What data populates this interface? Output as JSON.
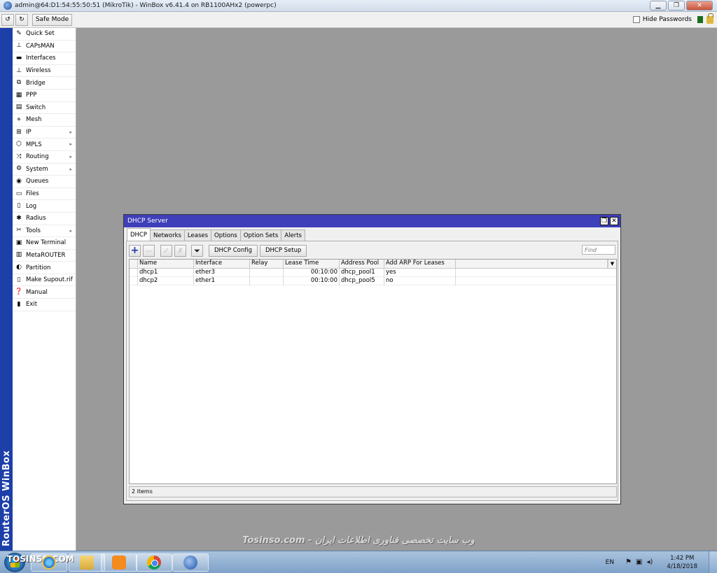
{
  "window": {
    "title": "admin@64:D1:54:55:50:51 (MikroTik) - WinBox v6.41.4 on RB1100AHx2 (powerpc)",
    "minimize": "▁",
    "maximize": "❐",
    "close": "✕"
  },
  "toolbar": {
    "undo_icon": "↺",
    "redo_icon": "↻",
    "safe_mode": "Safe Mode",
    "hide_passwords": "Hide Passwords"
  },
  "brand": "RouterOS WinBox",
  "sidebar": {
    "items": [
      {
        "label": "Quick Set",
        "icon": "✎",
        "has_submenu": false
      },
      {
        "label": "CAPsMAN",
        "icon": "⊥",
        "has_submenu": false
      },
      {
        "label": "Interfaces",
        "icon": "▬",
        "has_submenu": false
      },
      {
        "label": "Wireless",
        "icon": "⊥",
        "has_submenu": false
      },
      {
        "label": "Bridge",
        "icon": "⧉",
        "has_submenu": false
      },
      {
        "label": "PPP",
        "icon": "▦",
        "has_submenu": false
      },
      {
        "label": "Switch",
        "icon": "▤",
        "has_submenu": false
      },
      {
        "label": "Mesh",
        "icon": "⋄",
        "has_submenu": false
      },
      {
        "label": "IP",
        "icon": "⊞",
        "has_submenu": true
      },
      {
        "label": "MPLS",
        "icon": "⬡",
        "has_submenu": true
      },
      {
        "label": "Routing",
        "icon": "⤨",
        "has_submenu": true
      },
      {
        "label": "System",
        "icon": "⚙",
        "has_submenu": true
      },
      {
        "label": "Queues",
        "icon": "◉",
        "has_submenu": false
      },
      {
        "label": "Files",
        "icon": "▭",
        "has_submenu": false
      },
      {
        "label": "Log",
        "icon": "▯",
        "has_submenu": false
      },
      {
        "label": "Radius",
        "icon": "✱",
        "has_submenu": false
      },
      {
        "label": "Tools",
        "icon": "✂",
        "has_submenu": true
      },
      {
        "label": "New Terminal",
        "icon": "▣",
        "has_submenu": false
      },
      {
        "label": "MetaROUTER",
        "icon": "▥",
        "has_submenu": false
      },
      {
        "label": "Partition",
        "icon": "◐",
        "has_submenu": false
      },
      {
        "label": "Make Supout.rif",
        "icon": "▯",
        "has_submenu": false
      },
      {
        "label": "Manual",
        "icon": "❓",
        "has_submenu": false
      },
      {
        "label": "Exit",
        "icon": "▮",
        "has_submenu": false
      }
    ],
    "submenu_arrow": "▸"
  },
  "dhcp_window": {
    "title": "DHCP Server",
    "restore_icon": "❐",
    "close_icon": "✕",
    "tabs": [
      "DHCP",
      "Networks",
      "Leases",
      "Options",
      "Option Sets",
      "Alerts"
    ],
    "active_tab": "DHCP",
    "buttons": {
      "add": "+",
      "remove": "—",
      "enable": "✓",
      "disable": "✗",
      "filter": "⏷",
      "dhcp_config": "DHCP Config",
      "dhcp_setup": "DHCP Setup"
    },
    "find_placeholder": "Find",
    "columns": [
      "Name",
      "Interface",
      "Relay",
      "Lease Time",
      "Address Pool",
      "Add ARP For Leases"
    ],
    "column_dropdown": "▼",
    "rows": [
      {
        "name": "dhcp1",
        "interface": "ether3",
        "relay": "",
        "lease_time": "00:10:00",
        "address_pool": "dhcp_pool1",
        "add_arp": "yes"
      },
      {
        "name": "dhcp2",
        "interface": "ether1",
        "relay": "",
        "lease_time": "00:10:00",
        "address_pool": "dhcp_pool5",
        "add_arp": "no"
      }
    ],
    "status": "2 items"
  },
  "watermark": "Tosinso.com - وب سایت تخصصی فناوری اطلاعات ایران",
  "taskbar": {
    "logo_text": "TOSINSO.COM",
    "language": "EN",
    "time": "1:42 PM",
    "date": "4/18/2018"
  },
  "colors": {
    "brand_strip": "#1c3fa8",
    "dhcp_title_bar": "#3f3fba",
    "desktop": "#9a9a9a"
  }
}
